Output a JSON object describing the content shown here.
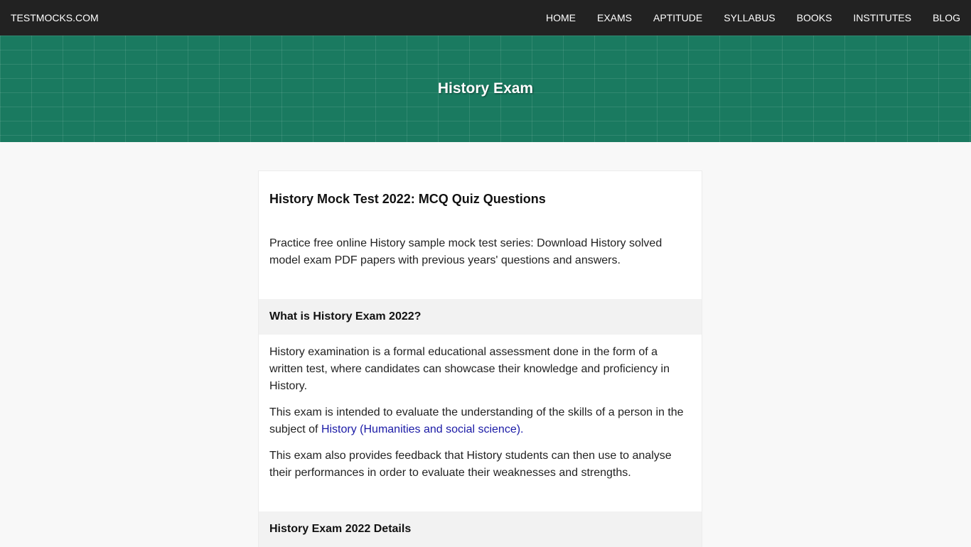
{
  "nav": {
    "brand": "TESTMOCKS.COM",
    "items": [
      {
        "label": "HOME"
      },
      {
        "label": "EXAMS"
      },
      {
        "label": "APTITUDE"
      },
      {
        "label": "SYLLABUS"
      },
      {
        "label": "BOOKS"
      },
      {
        "label": "INSTITUTES"
      },
      {
        "label": "BLOG"
      }
    ]
  },
  "hero": {
    "title": "History Exam"
  },
  "article": {
    "title": "History Mock Test 2022: MCQ Quiz Questions",
    "intro": "Practice free online History sample mock test series: Download History solved model exam PDF papers with previous years' questions and answers.",
    "sections": [
      {
        "heading": "What is History Exam 2022?",
        "p1": "History examination is a formal educational assessment done in the form of a written test, where candidates can showcase their knowledge and proficiency in History.",
        "p2_prefix": "This exam is intended to evaluate the understanding of the skills of a person in the subject of ",
        "p2_link": "History (Humanities and social science).",
        "p3": "This exam also provides feedback that History students can then use to analyse their performances in order to evaluate their weaknesses and strengths."
      },
      {
        "heading": "History Exam 2022 Details"
      }
    ]
  },
  "colors": {
    "nav_bg": "#222222",
    "hero_bg": "#1a7a60",
    "link": "#1a1aa6",
    "section_head_bg": "#f2f2f2",
    "page_bg": "#f8f8f8"
  }
}
